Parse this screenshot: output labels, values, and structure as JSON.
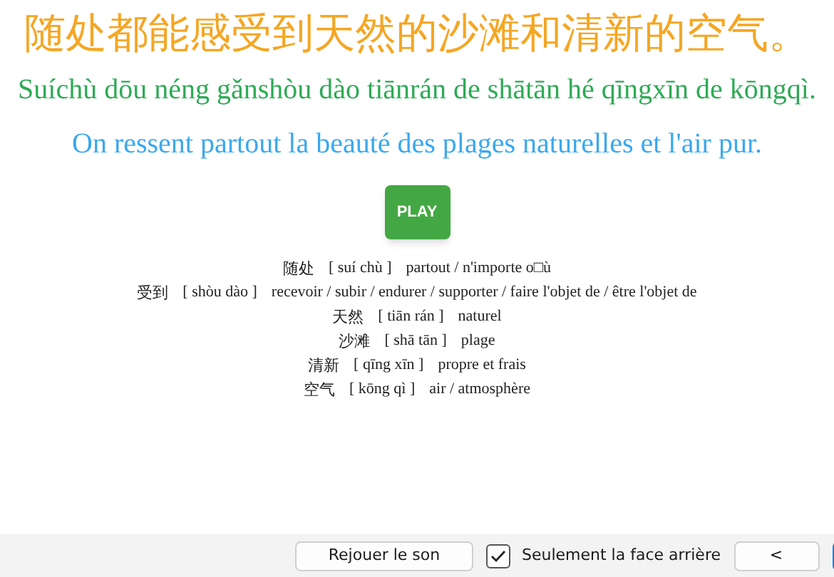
{
  "sentence": {
    "hanzi": "随处都能感受到天然的沙滩和清新的空气。",
    "pinyin": "Suíchù dōu néng gǎnshòu dào tiānrán de shātān hé qīngxīn de kōngqì.",
    "translation": "On ressent partout la beauté des plages naturelles et l'air pur."
  },
  "play_button": "PLAY",
  "vocabulary": [
    {
      "word": "随处",
      "pinyin": "[ suí chù ]",
      "meaning": "partout / n'importe o□ù"
    },
    {
      "word": "受到",
      "pinyin": "[ shòu dào ]",
      "meaning": "recevoir / subir / endurer / supporter / faire l'objet de / être l'objet de"
    },
    {
      "word": "天然",
      "pinyin": "[ tiān rán ]",
      "meaning": "naturel"
    },
    {
      "word": "沙滩",
      "pinyin": "[ shā tān ]",
      "meaning": "plage"
    },
    {
      "word": "清新",
      "pinyin": "[ qīng xīn ]",
      "meaning": "propre et frais"
    },
    {
      "word": "空气",
      "pinyin": "[ kōng qì ]",
      "meaning": "air / atmosphère"
    }
  ],
  "toolbar": {
    "replay_button": "Rejouer le son",
    "back_only": {
      "label": "Seulement la face arrière",
      "checked": true
    },
    "prev_button": "<"
  }
}
